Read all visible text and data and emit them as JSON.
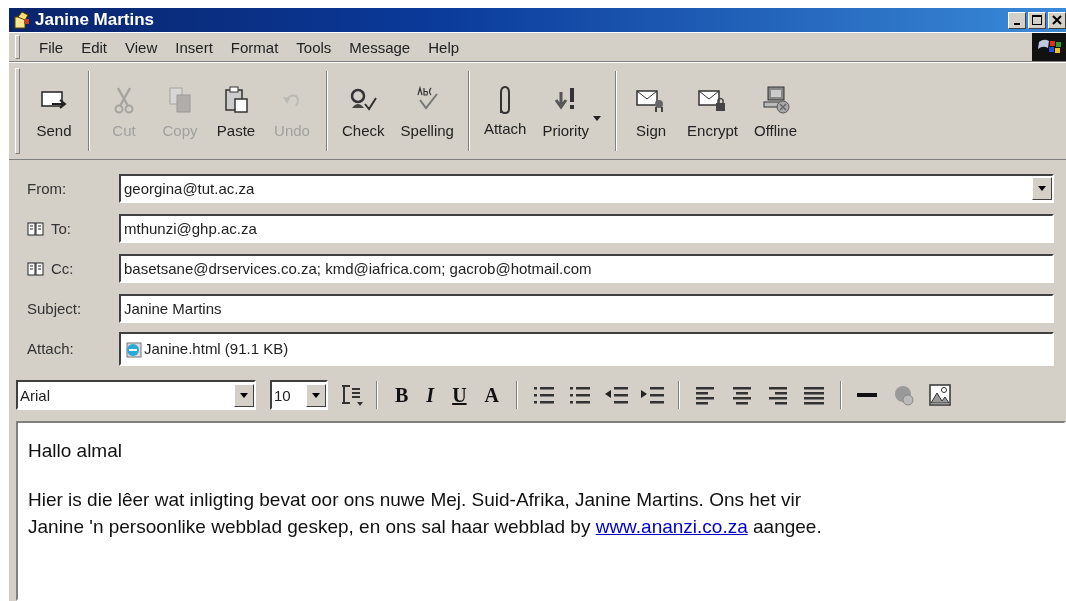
{
  "window": {
    "title": "Janine Martins"
  },
  "menu": [
    "File",
    "Edit",
    "View",
    "Insert",
    "Format",
    "Tools",
    "Message",
    "Help"
  ],
  "toolbar": [
    {
      "label": "Send",
      "disabled": false
    },
    {
      "label": "Cut",
      "disabled": true,
      "separator": true
    },
    {
      "label": "Copy",
      "disabled": true
    },
    {
      "label": "Paste",
      "disabled": false
    },
    {
      "label": "Undo",
      "disabled": true
    },
    {
      "label": "Check",
      "disabled": false,
      "separator": true
    },
    {
      "label": "Spelling",
      "disabled": false
    },
    {
      "label": "Attach",
      "disabled": false,
      "separator": true
    },
    {
      "label": "Priority",
      "disabled": false,
      "dropdown": true
    },
    {
      "label": "Sign",
      "disabled": false,
      "separator": true
    },
    {
      "label": "Encrypt",
      "disabled": false
    },
    {
      "label": "Offline",
      "disabled": false
    }
  ],
  "header": [
    {
      "label": "From:",
      "value": "georgina@tut.ac.za",
      "kind": "dropdown"
    },
    {
      "label": "To:",
      "value": "mthunzi@ghp.ac.za",
      "kind": "address"
    },
    {
      "label": "Cc:",
      "value": "basetsane@drservices.co.za; kmd@iafrica.com; gacrob@hotmail.com",
      "kind": "address"
    },
    {
      "label": "Subject:",
      "value": "Janine Martins",
      "kind": "text"
    },
    {
      "label": "Attach:",
      "value": "Janine.html (91.1 KB)",
      "kind": "attachment"
    }
  ],
  "format_bar": {
    "font": "Arial",
    "size": "10",
    "style_buttons": [
      "B",
      "I",
      "U",
      "A"
    ]
  },
  "body": [
    {
      "parts": [
        {
          "kind": "text",
          "text": "Hallo almal"
        }
      ]
    },
    {
      "parts": [
        {
          "kind": "text",
          "text": "Hier is die lêer wat inligting bevat oor ons nuwe Mej. Suid-Afrika, Janine Martins. Ons het vir"
        },
        {
          "kind": "break"
        },
        {
          "kind": "text",
          "text": "Janine 'n persoonlike webblad geskep, en ons sal haar webblad by "
        },
        {
          "kind": "link",
          "text": "www.ananzi.co.za"
        },
        {
          "kind": "text",
          "text": " aangee."
        }
      ]
    }
  ]
}
